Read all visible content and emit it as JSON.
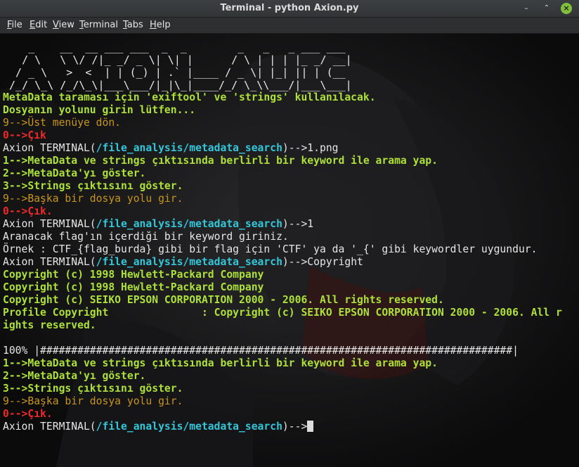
{
  "window": {
    "title": "Terminal - python Axion.py",
    "buttons": {
      "minimize": "–",
      "maximize": "⌃",
      "close": "×"
    }
  },
  "menu": [
    {
      "label": "File",
      "mnemonic": "F",
      "rest": "ile"
    },
    {
      "label": "Edit",
      "mnemonic": "E",
      "rest": "dit"
    },
    {
      "label": "View",
      "mnemonic": "V",
      "rest": "iew"
    },
    {
      "label": "Terminal",
      "mnemonic": "T",
      "rest": "erminal"
    },
    {
      "label": "Tabs",
      "mnemonic": "T",
      "rest": "abs"
    },
    {
      "label": "Help",
      "mnemonic": "H",
      "rest": "elp"
    }
  ],
  "banner": [
    "    _    __  __ ___ ___  _  _        _   _   _ ___ ___ ",
    "   / \\   \\ \\/ /|_ _/ _ \\| \\| |      / \\ | | | |_ _/ __|",
    "  / _ \\   >  <  | | (_) | .` |____ / _ \\| |_| || | (__ ",
    " /_/ \\_\\ /_/\\_\\|___\\___/|_|\\_|____/_/ \\_\\\\___/|___\\___|"
  ],
  "lines": [
    [
      {
        "t": "MetaData taraması için 'exiftool' ve 'strings' kullanılacak.",
        "s": "g"
      }
    ],
    [
      {
        "t": "Dosyanın yolunu girin lütfen...",
        "s": "g"
      }
    ],
    [
      {
        "t": "9-->Üst menüye dön.",
        "s": "o"
      }
    ],
    [
      {
        "t": "0-->Çık",
        "s": "r"
      }
    ],
    [
      {
        "t": "Axion TERMINAL(",
        "s": "w"
      },
      {
        "t": "/file_analysis/metadata_search",
        "s": "c"
      },
      {
        "t": ")-->1.png",
        "s": "w"
      }
    ],
    [
      {
        "t": "1-->MetaData ve strings çıktısında berlirli bir keyword ile arama yap.",
        "s": "g"
      }
    ],
    [
      {
        "t": "2-->MetaData'yı göster.",
        "s": "g"
      }
    ],
    [
      {
        "t": "3-->Strings çıktısını göster.",
        "s": "g"
      }
    ],
    [
      {
        "t": "9-->Başka bir dosya yolu gir.",
        "s": "o"
      }
    ],
    [
      {
        "t": "0-->Çık.",
        "s": "r"
      }
    ],
    [
      {
        "t": "Axion TERMINAL(",
        "s": "w"
      },
      {
        "t": "/file_analysis/metadata_search",
        "s": "c"
      },
      {
        "t": ")-->1",
        "s": "w"
      }
    ],
    [
      {
        "t": "Aranacak flag'ın içerdiği bir keyword giriniz.",
        "s": "w"
      }
    ],
    [
      {
        "t": "Örnek : CTF_{flag_burda} gibi bir flag için 'CTF' ya da '_{' gibi keywordler uygundur.",
        "s": "w"
      }
    ],
    [
      {
        "t": "Axion TERMINAL(",
        "s": "w"
      },
      {
        "t": "/file_analysis/metadata_search",
        "s": "c"
      },
      {
        "t": ")-->Copyright",
        "s": "w"
      }
    ],
    [
      {
        "t": "Copyright (c) 1998 Hewlett-Packard Company",
        "s": "g"
      }
    ],
    [
      {
        "t": "Copyright (c) 1998 Hewlett-Packard Company",
        "s": "g"
      }
    ],
    [
      {
        "t": "Copyright (c) SEIKO EPSON CORPORATION 2000 - 2006. All rights reserved.",
        "s": "g"
      }
    ],
    [
      {
        "t": "Profile Copyright               : Copyright (c) SEIKO EPSON CORPORATION 2000 - 2006. All r",
        "s": "g"
      }
    ],
    [
      {
        "t": "ights reserved.",
        "s": "g"
      }
    ],
    [
      {
        "t": "",
        "s": "w"
      }
    ],
    [
      {
        "t": "100% |############################################################################|",
        "s": "w"
      }
    ],
    [
      {
        "t": "1-->MetaData ve strings çıktısında berlirli bir keyword ile arama yap.",
        "s": "g"
      }
    ],
    [
      {
        "t": "2-->MetaData'yı göster.",
        "s": "g"
      }
    ],
    [
      {
        "t": "3-->Strings çıktısını göster.",
        "s": "g"
      }
    ],
    [
      {
        "t": "9-->Başka bir dosya yolu gir.",
        "s": "o"
      }
    ],
    [
      {
        "t": "0-->Çık.",
        "s": "r"
      }
    ],
    [
      {
        "t": "Axion TERMINAL(",
        "s": "w"
      },
      {
        "t": "/file_analysis/metadata_search",
        "s": "c"
      },
      {
        "t": ")-->",
        "s": "w"
      }
    ]
  ],
  "colors": {
    "green": "#aee03a",
    "orange": "#c8951c",
    "red": "#ef2929",
    "cyan": "#34c6d9",
    "text": "#e6e6e6",
    "background": "#0b0b0c"
  }
}
